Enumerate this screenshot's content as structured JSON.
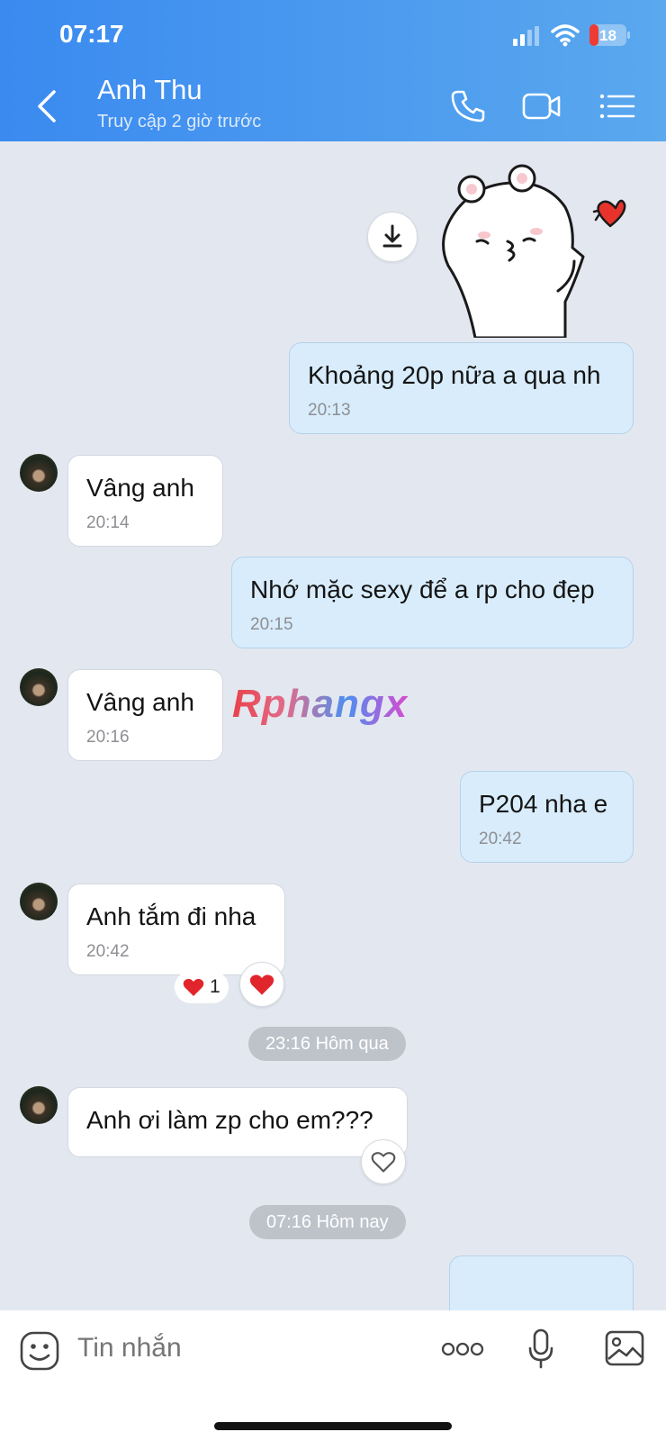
{
  "status_bar": {
    "time": "07:17",
    "battery": "18"
  },
  "header": {
    "contact_name": "Anh Thu",
    "last_seen": "Truy cập 2 giờ trước"
  },
  "messages": [
    {
      "dir": "out",
      "text": "Khoảng 20p nữa a qua nh",
      "time": "20:13"
    },
    {
      "dir": "in",
      "text": "Vâng anh",
      "time": "20:14"
    },
    {
      "dir": "out",
      "text": "Nhớ mặc sexy để a rp cho đẹp",
      "time": "20:15"
    },
    {
      "dir": "in",
      "text": "Vâng anh",
      "time": "20:16"
    },
    {
      "dir": "out",
      "text": "P204 nha e",
      "time": "20:42"
    },
    {
      "dir": "in",
      "text": "Anh tắm đi nha",
      "time": "20:42",
      "reaction_count": "1"
    },
    {
      "dir": "in",
      "text": "Anh ơi làm zp cho em???"
    },
    {
      "dir": "out",
      "text": ""
    }
  ],
  "dividers": [
    "23:16 Hôm qua",
    "07:16 Hôm nay"
  ],
  "watermark": "Rphangx",
  "composer": {
    "placeholder": "Tin nhắn"
  }
}
